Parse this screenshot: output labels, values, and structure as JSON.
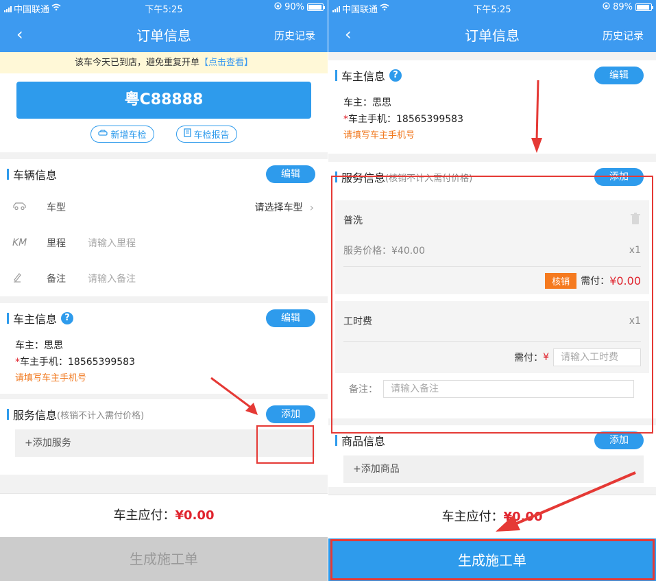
{
  "colors": {
    "accent": "#3d9af0",
    "button_blue": "#2e9bec",
    "red": "#e0242e",
    "orange": "#f57a1f",
    "annotation_red": "#e53935"
  },
  "left": {
    "status": {
      "carrier": "中国联通",
      "time": "下午5:25",
      "battery": "90%",
      "battery_level": 0.9
    },
    "nav": {
      "back": "‹",
      "title": "订单信息",
      "history": "历史记录"
    },
    "notice": {
      "text": "该车今天已到店，避免重复开单",
      "link": "【点击查看】"
    },
    "plate": "粤C88888",
    "actions": {
      "new_inspection": "新增车检",
      "inspection_report": "车检报告"
    },
    "vehicle": {
      "title": "车辆信息",
      "edit": "编辑",
      "model_label": "车型",
      "model_value": "请选择车型",
      "mileage_icon": "KM",
      "mileage_label": "里程",
      "mileage_placeholder": "请输入里程",
      "note_label": "备注",
      "note_placeholder": "请输入备注"
    },
    "owner": {
      "title": "车主信息",
      "help": "?",
      "edit": "编辑",
      "name": "车主：思思",
      "req": "*",
      "phone": "车主手机：18565399583",
      "warn": "请填写车主手机号"
    },
    "service": {
      "title": "服务信息",
      "sub": "(核销不计入需付价格)",
      "add": "添加",
      "add_line": "+添加服务"
    },
    "pay": {
      "label": "车主应付：",
      "amount": "¥0.00"
    },
    "generate": "生成施工单"
  },
  "right": {
    "status": {
      "carrier": "中国联通",
      "time": "下午5:25",
      "battery": "89%",
      "battery_level": 0.89
    },
    "nav": {
      "back": "‹",
      "title": "订单信息",
      "history": "历史记录"
    },
    "owner": {
      "title": "车主信息",
      "help": "?",
      "edit": "编辑",
      "name": "车主：思思",
      "req": "*",
      "phone": "车主手机：18565399583",
      "warn": "请填写车主手机号"
    },
    "service": {
      "title": "服务信息",
      "sub": "(核销不计入需付价格)",
      "add": "添加",
      "item1": {
        "name": "普洗",
        "price": "服务价格：¥40.00",
        "qty": "x1",
        "verify": "核销",
        "pay_label": "需付：",
        "pay_value": "¥0.00"
      },
      "item2": {
        "name": "工时费",
        "qty": "x1",
        "pay_label": "需付：",
        "currency": "¥",
        "placeholder": "请输入工时费"
      },
      "note_label": "备注：",
      "note_placeholder": "请输入备注"
    },
    "goods": {
      "title": "商品信息",
      "add": "添加",
      "add_line": "+添加商品"
    },
    "pay": {
      "label": "车主应付：",
      "amount": "¥0.00"
    },
    "generate": "生成施工单"
  }
}
